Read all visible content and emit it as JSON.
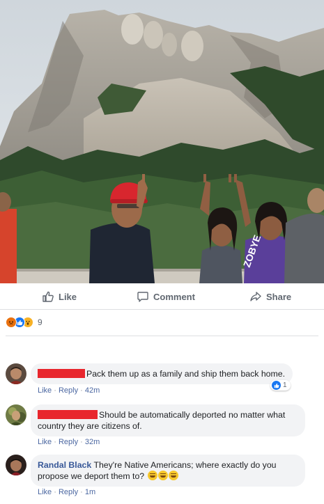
{
  "post": {
    "photo_alt": "Mount Rushmore photo"
  },
  "actions": {
    "like_label": "Like",
    "comment_label": "Comment",
    "share_label": "Share"
  },
  "reactions": {
    "icons": [
      "angry-icon",
      "like-icon",
      "wow-icon"
    ],
    "count": "9"
  },
  "comments": [
    {
      "author": "",
      "author_redacted": true,
      "text": "Pack them up as a family and ship them back home.",
      "like_label": "Like",
      "reply_label": "Reply",
      "time": "42m",
      "like_count": "1"
    },
    {
      "author": "",
      "author_redacted": true,
      "text": "Should be automatically deported no matter what country they are citizens of.",
      "like_label": "Like",
      "reply_label": "Reply",
      "time": "32m"
    },
    {
      "author": "Randal Black",
      "author_redacted": false,
      "text": "They're Native Americans; where exactly do you propose we deport them to?",
      "emojis": [
        "grinning-sweat-emoji",
        "grinning-sweat-emoji",
        "grinning-sweat-emoji"
      ],
      "like_label": "Like",
      "reply_label": "Reply",
      "time": "1m"
    }
  ],
  "colors": {
    "link": "#385898",
    "meta_link": "#4b67a1",
    "redaction": "#e8262d",
    "bubble": "#f2f3f5",
    "like_blue": "#1877f2"
  }
}
